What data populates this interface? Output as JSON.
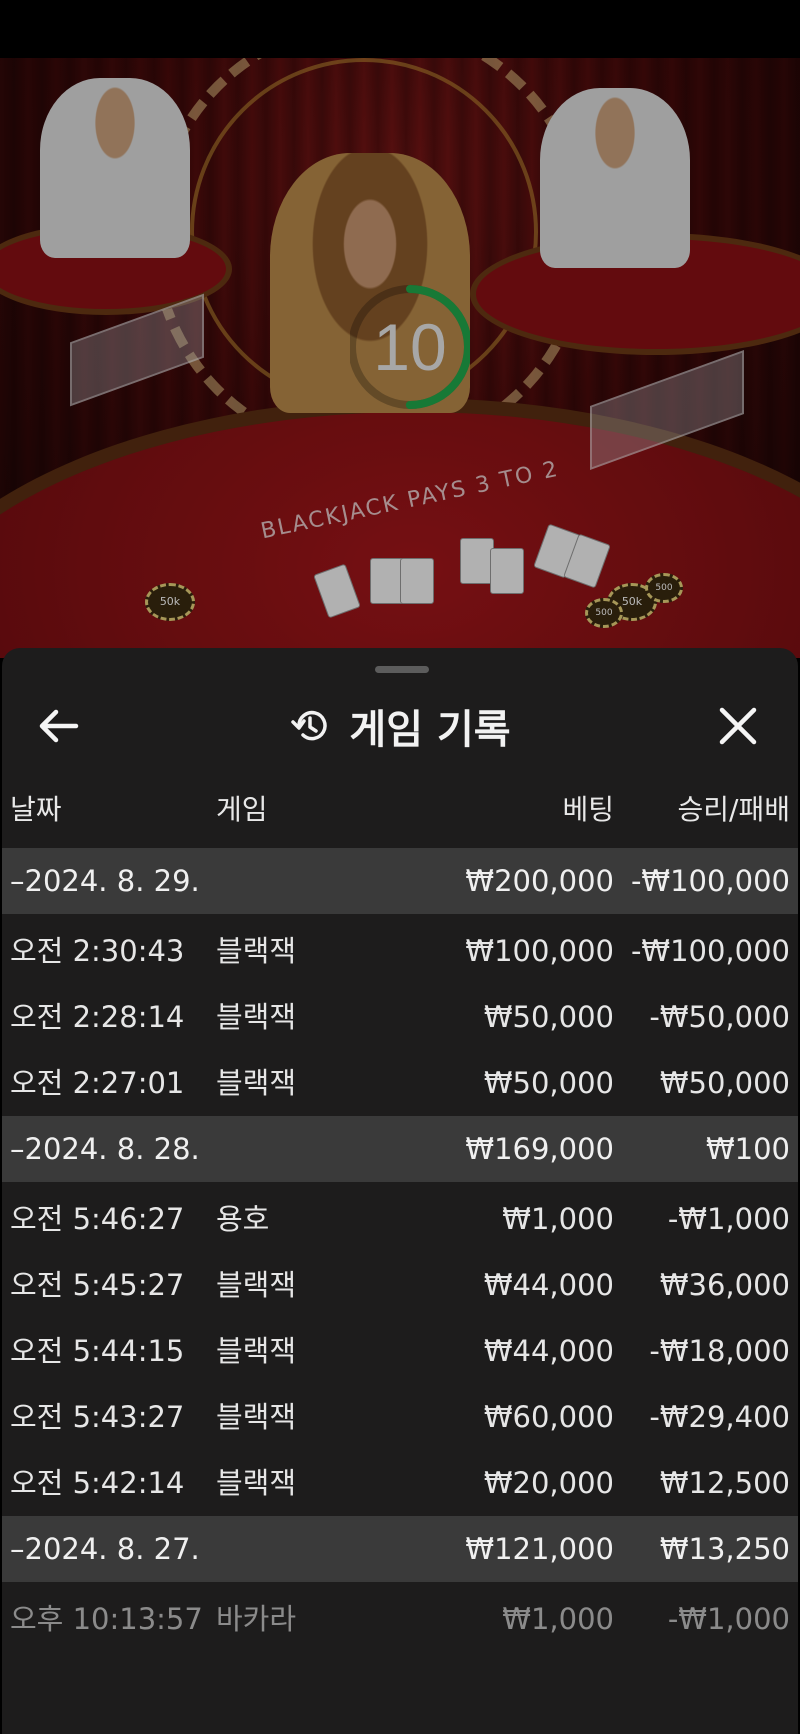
{
  "timer": {
    "value": "10",
    "progress": 0.5,
    "color": "#21a84b"
  },
  "video": {
    "felt_text": "BLACKJACK PAYS 3 TO 2",
    "chips": [
      "50k",
      "50k",
      "500",
      "500"
    ]
  },
  "sheet": {
    "title": "게임 기록",
    "icons": {
      "back": "arrow-left-icon",
      "history": "history-icon",
      "close": "close-icon"
    }
  },
  "columns": {
    "date": "날짜",
    "game": "게임",
    "bet": "베팅",
    "win_loss": "승리/패배"
  },
  "groups": [
    {
      "date": "–2024. 8. 29.",
      "bet": "₩200,000",
      "win_loss": "-₩100,000",
      "rows": [
        {
          "time": "오전 2:30:43",
          "game": "블랙잭",
          "bet": "₩100,000",
          "win_loss": "-₩100,000"
        },
        {
          "time": "오전 2:28:14",
          "game": "블랙잭",
          "bet": "₩50,000",
          "win_loss": "-₩50,000"
        },
        {
          "time": "오전 2:27:01",
          "game": "블랙잭",
          "bet": "₩50,000",
          "win_loss": "₩50,000"
        }
      ]
    },
    {
      "date": "–2024. 8. 28.",
      "bet": "₩169,000",
      "win_loss": "₩100",
      "rows": [
        {
          "time": "오전 5:46:27",
          "game": "용호",
          "bet": "₩1,000",
          "win_loss": "-₩1,000"
        },
        {
          "time": "오전 5:45:27",
          "game": "블랙잭",
          "bet": "₩44,000",
          "win_loss": "₩36,000"
        },
        {
          "time": "오전 5:44:15",
          "game": "블랙잭",
          "bet": "₩44,000",
          "win_loss": "-₩18,000"
        },
        {
          "time": "오전 5:43:27",
          "game": "블랙잭",
          "bet": "₩60,000",
          "win_loss": "-₩29,400"
        },
        {
          "time": "오전 5:42:14",
          "game": "블랙잭",
          "bet": "₩20,000",
          "win_loss": "₩12,500"
        }
      ]
    },
    {
      "date": "–2024. 8. 27.",
      "bet": "₩121,000",
      "win_loss": "₩13,250",
      "rows": [
        {
          "time": "오후 10:13:57",
          "game": "바카라",
          "bet": "₩1,000",
          "win_loss": "-₩1,000"
        }
      ]
    }
  ]
}
